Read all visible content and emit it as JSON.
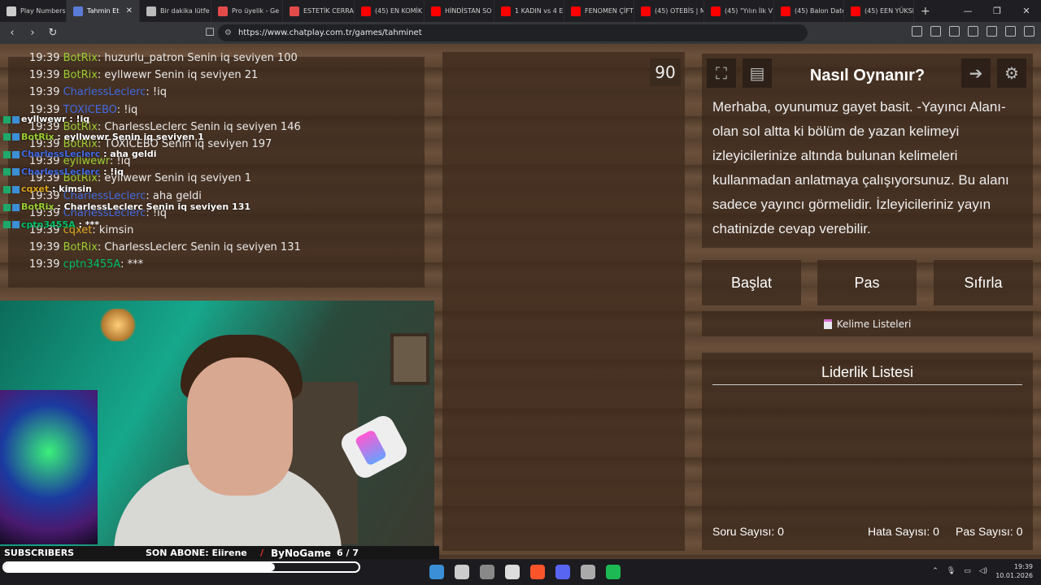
{
  "browser": {
    "tabs": [
      {
        "label": "Play Numbers |",
        "color": "#cccccc",
        "active": false
      },
      {
        "label": "Tahmin Et",
        "color": "#5a7bd6",
        "active": true
      },
      {
        "label": "Bir dakika lütfe",
        "color": "#bbbbbb",
        "active": false
      },
      {
        "label": "Pro üyelik - Ge",
        "color": "#e34b4b",
        "active": false
      },
      {
        "label": "ESTETİK CERRA",
        "color": "#e34b4b",
        "active": false
      },
      {
        "label": "(45) EN KOMİK",
        "color": "#ff0000",
        "active": false
      },
      {
        "label": "HİNDİSTAN SO",
        "color": "#ff0000",
        "active": false
      },
      {
        "label": "1 KADIN vs 4 E",
        "color": "#ff0000",
        "active": false
      },
      {
        "label": "FENOMEN ÇİFT",
        "color": "#ff0000",
        "active": false
      },
      {
        "label": "(45) OTEBİS | M",
        "color": "#ff0000",
        "active": false
      },
      {
        "label": "(45) \"Yılın İlk V",
        "color": "#ff0000",
        "active": false
      },
      {
        "label": "(45) Balon Date",
        "color": "#ff0000",
        "active": false
      },
      {
        "label": "(45) EEN YÜKSE",
        "color": "#ff0000",
        "active": false
      }
    ],
    "new_tab": "+",
    "url": "https://www.chatplay.com.tr/games/tahminet"
  },
  "chat": {
    "lines": [
      {
        "time": "19:39",
        "user": "BotRix",
        "cls": "bot",
        "msg": ": huzurlu_patron Senin iq seviyen 100"
      },
      {
        "time": "19:39",
        "user": "BotRix",
        "cls": "bot",
        "msg": ": eyllwewr Senin iq seviyen 21"
      },
      {
        "time": "19:39",
        "user": "CharlessLeclerc",
        "cls": "blue",
        "msg": ": !iq"
      },
      {
        "time": "19:39",
        "user": "TOXICEBO",
        "cls": "blue",
        "msg": ": !iq"
      },
      {
        "time": "19:39",
        "user": "BotRix",
        "cls": "bot",
        "msg": ": CharlessLeclerc Senin iq seviyen 146"
      },
      {
        "time": "19:39",
        "user": "BotRix",
        "cls": "bot",
        "msg": ": TOXICEBO Senin iq seviyen 197"
      },
      {
        "time": "19:39",
        "user": "eyllwewr",
        "cls": "bot",
        "msg": ": !iq"
      },
      {
        "time": "19:39",
        "user": "BotRix",
        "cls": "bot",
        "msg": ": eyllwewr Senin iq seviyen 1"
      },
      {
        "time": "19:39",
        "user": "CharlessLeclerc",
        "cls": "blue",
        "msg": ": aha geldi"
      },
      {
        "time": "19:39",
        "user": "CharlessLeclerc",
        "cls": "blue",
        "msg": ": !iq"
      },
      {
        "time": "19:39",
        "user": "cqxet",
        "cls": "orange",
        "msg": ": kimsin"
      },
      {
        "time": "19:39",
        "user": "BotRix",
        "cls": "bot",
        "msg": ": CharlessLeclerc Senin iq seviyen 131"
      },
      {
        "time": "19:39",
        "user": "cptn3455A",
        "cls": "green",
        "msg": ": ***"
      }
    ],
    "overlay": [
      {
        "user": "eyllwewr",
        "cls": "",
        "msg": " : !iq"
      },
      {
        "user": "BotRix",
        "cls": "bot",
        "msg": " : eyllwewr Senin iq seviyen 1"
      },
      {
        "user": "CharlessLeclerc",
        "cls": "blue",
        "msg": " : aha geldi"
      },
      {
        "user": "CharlessLeclerc",
        "cls": "blue",
        "msg": " : !iq"
      },
      {
        "user": "cqxet",
        "cls": "orange",
        "msg": " : kimsin"
      },
      {
        "user": "BotRix",
        "cls": "bot",
        "msg": " : CharlessLeclerc Senin iq seviyen 131"
      },
      {
        "user": "cptn3455A",
        "cls": "green",
        "msg": " : ***"
      }
    ]
  },
  "game": {
    "timer": "90",
    "how_title": "Nasıl Oynanır?",
    "how_text": "Merhaba, oyunumuz gayet basit. -Yayıncı Alanı- olan sol altta ki bölüm de yazan kelimeyi izleyicilerinize altında bulunan kelimeleri kullanmadan anlatmaya çalışıyorsunuz. Bu alanı sadece yayıncı görmelidir. İzleyicileriniz yayın chatinizde cevap verebilir.",
    "start_label": "Başlat",
    "pass_label": "Pas",
    "reset_label": "Sıfırla",
    "word_lists_label": "Kelime Listeleri",
    "leaderboard_title": "Liderlik Listesi",
    "question_count": "Soru Sayısı: 0",
    "error_count": "Hata Sayısı: 0",
    "pass_count": "Pas Sayısı: 0"
  },
  "stream": {
    "subscribers_label": "SUBSCRIBERS",
    "last_sub": "SON ABONE: Eiirene",
    "channel": "ByNoGame",
    "goal": "6 / 7",
    "goal_fraction": 0.857
  },
  "taskbar": {
    "time": "19:39",
    "date": "10.01.2026",
    "icons": [
      "#3a8fd6",
      "#cccccc",
      "#888888",
      "#dddddd",
      "#fb542b",
      "#5865f2",
      "#aaaaaa",
      "#1db954"
    ]
  }
}
